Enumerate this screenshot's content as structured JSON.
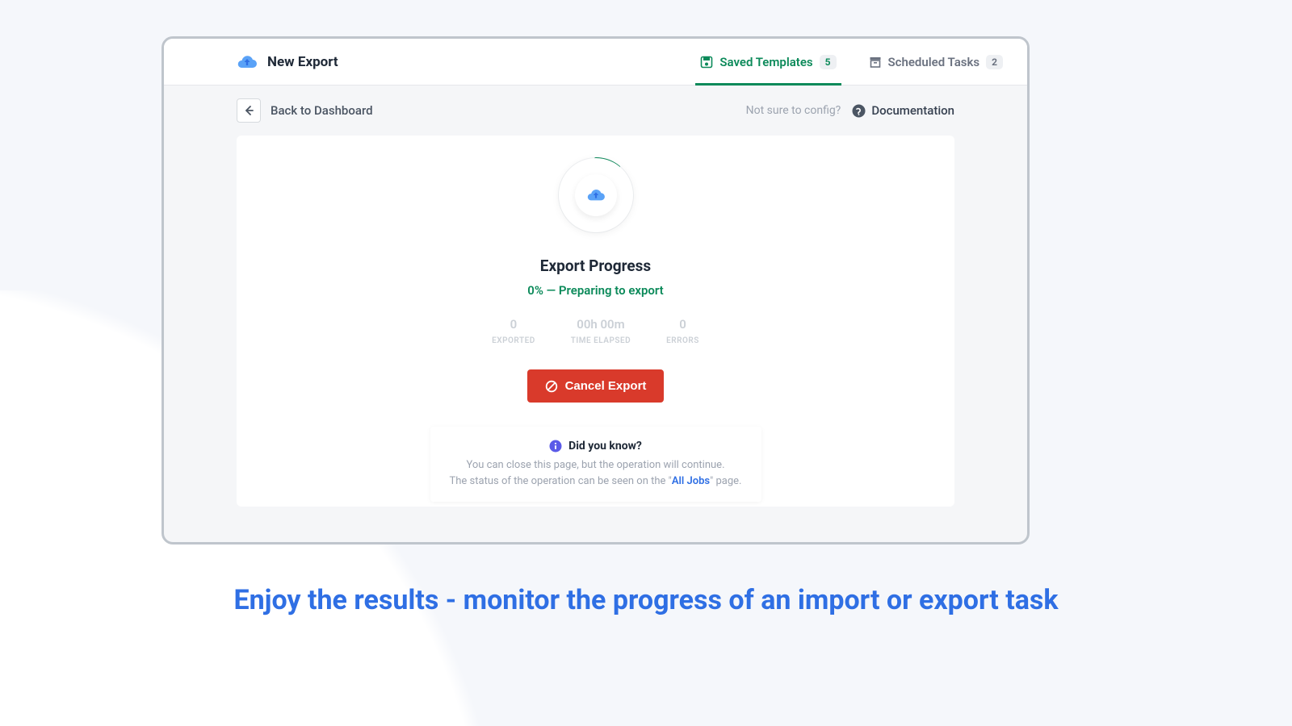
{
  "header": {
    "title": "New Export",
    "tabs": [
      {
        "label": "Saved Templates",
        "count": "5",
        "active": true
      },
      {
        "label": "Scheduled Tasks",
        "count": "2",
        "active": false
      }
    ]
  },
  "toolbar": {
    "back_label": "Back to Dashboard",
    "hint": "Not sure to config?",
    "doc_label": "Documentation"
  },
  "progress": {
    "title": "Export Progress",
    "status": "0% — Preparing to export",
    "stats": [
      {
        "value": "0",
        "label": "EXPORTED"
      },
      {
        "value": "00h 00m",
        "label": "TIME ELAPSED"
      },
      {
        "value": "0",
        "label": "ERRORS"
      }
    ],
    "cancel_label": "Cancel Export"
  },
  "tip": {
    "title": "Did you know?",
    "line1": "You can close this page, but the operation will continue.",
    "line2_pre": "The status of the operation can be seen on the \"",
    "link": "All Jobs",
    "line2_post": "\" page."
  },
  "caption": "Enjoy the results - monitor the progress of an import or export task",
  "colors": {
    "accent": "#0c8a5a",
    "primary_blue": "#2f6fe4",
    "danger": "#d93a2b"
  }
}
